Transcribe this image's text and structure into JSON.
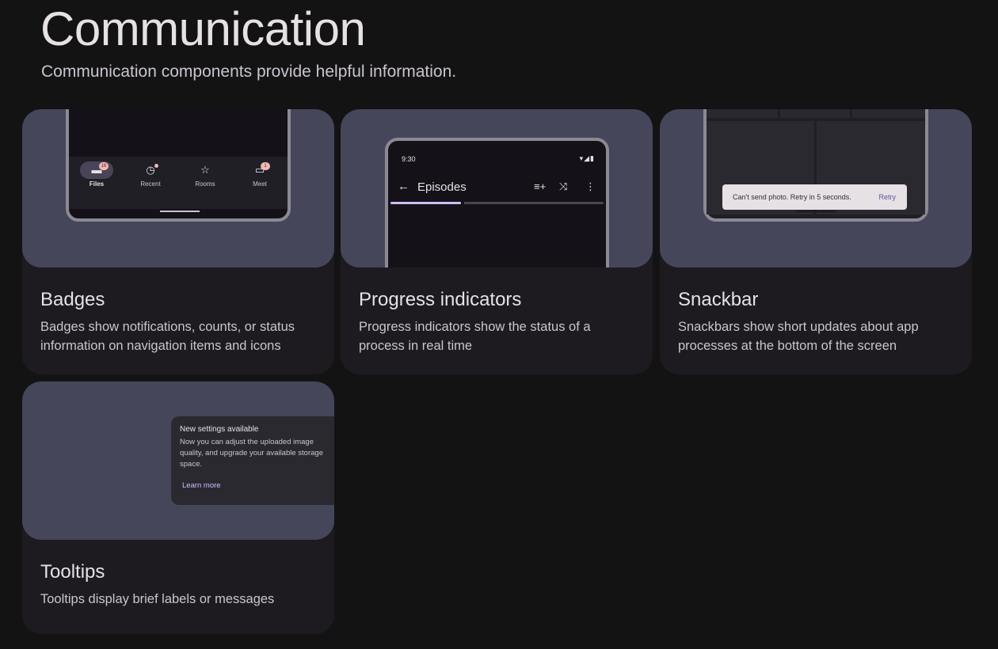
{
  "header": {
    "title": "Communication",
    "subtitle": "Communication components provide helpful information."
  },
  "cards": {
    "badges": {
      "title": "Badges",
      "description": "Badges show notifications, counts, or status information on navigation items and icons",
      "nav": [
        {
          "label": "Files",
          "icon": "folder-icon",
          "glyph": "▬",
          "badge": "16",
          "active": true
        },
        {
          "label": "Recent",
          "icon": "clock-icon",
          "glyph": "◷",
          "badge": "",
          "active": false
        },
        {
          "label": "Rooms",
          "icon": "star-icon",
          "glyph": "☆",
          "badge": "",
          "active": false
        },
        {
          "label": "Meet",
          "icon": "video-icon",
          "glyph": "▭",
          "badge": "1",
          "active": false
        }
      ]
    },
    "progress": {
      "title": "Progress indicators",
      "description": "Progress indicators show the status of a process in real time",
      "time": "9:30",
      "status_glyphs": "▾◢▮",
      "screen_title": "Episodes",
      "back_glyph": "←",
      "toolbar": {
        "queue": "≡+",
        "shuffle": "⤨",
        "more": "⋮"
      },
      "progress_fraction": 0.33
    },
    "snackbar": {
      "title": "Snackbar",
      "description": "Snackbars show short updates about app processes at the bottom of the screen",
      "message": "Can't send photo. Retry in 5 seconds.",
      "action": "Retry"
    },
    "tooltips": {
      "title": "Tooltips",
      "description": "Tooltips display brief labels or messages",
      "tooltip_title": "New settings available",
      "tooltip_body": "Now you can adjust the uploaded image quality, and upgrade your available storage space.",
      "tooltip_action": "Learn more"
    }
  },
  "colors": {
    "background": "#141314",
    "card": "#1d1b20",
    "hero": "#46465a",
    "accent": "#d0bcff",
    "badge": "#f2b8b5"
  }
}
